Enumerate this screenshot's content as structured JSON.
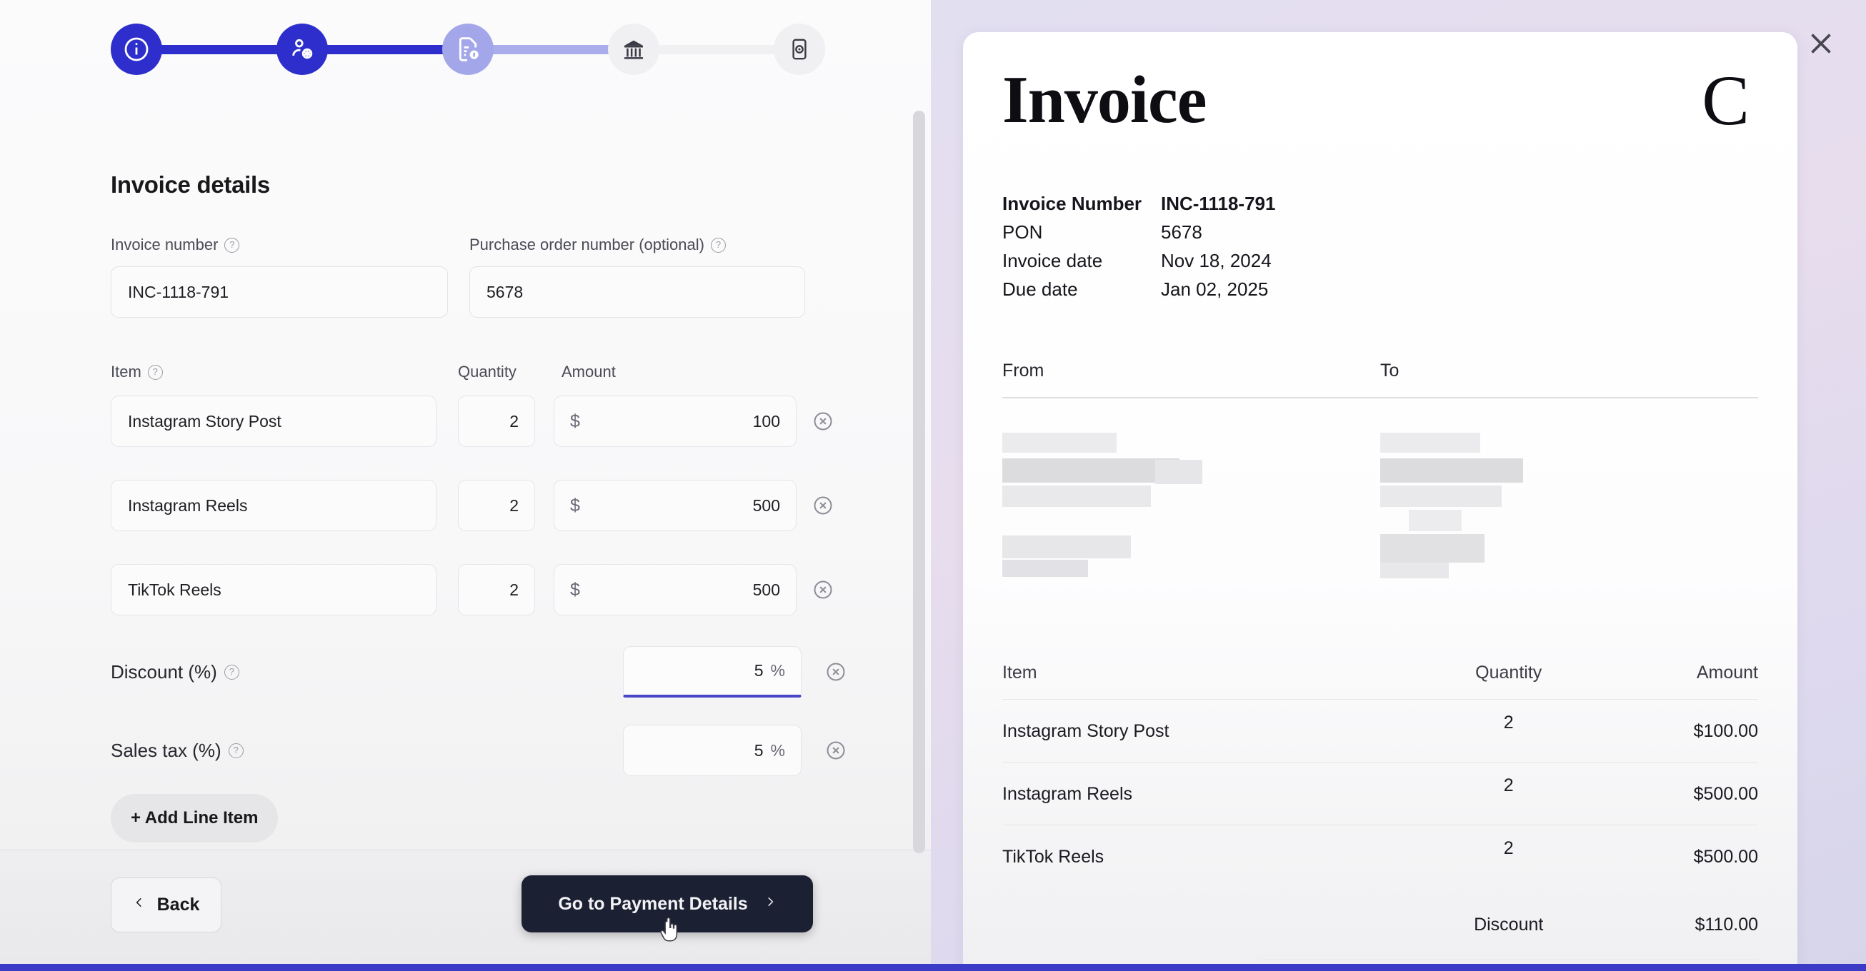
{
  "stepper": {
    "steps": [
      {
        "name": "business-info",
        "icon": "info-icon",
        "state": "done"
      },
      {
        "name": "client-details",
        "icon": "user-package-icon",
        "state": "done"
      },
      {
        "name": "invoice-details",
        "icon": "invoice-document-icon",
        "state": "current"
      },
      {
        "name": "payment-details",
        "icon": "bank-icon",
        "state": "todo"
      },
      {
        "name": "review-send",
        "icon": "preview-phone-icon",
        "state": "todo"
      }
    ],
    "colors": {
      "done": "#2e2ecc",
      "current": "#a3a7ea",
      "todo": "#f0f0f3"
    }
  },
  "form": {
    "title": "Invoice details",
    "invoice_number": {
      "label": "Invoice number",
      "value": "INC-1118-791",
      "placeholder": "Invoice number",
      "help": "?"
    },
    "purchase_order": {
      "label": "Purchase order number (optional)",
      "value": "5678",
      "placeholder": "Purchase order number",
      "help": "?"
    },
    "line_item_headers": {
      "item": "Item",
      "quantity": "Quantity",
      "amount": "Amount",
      "help": "?"
    },
    "currency_symbol": "$",
    "line_items": [
      {
        "item": "Instagram Story Post",
        "quantity": "2",
        "amount": "100"
      },
      {
        "item": "Instagram Reels",
        "quantity": "2",
        "amount": "500"
      },
      {
        "item": "TikTok Reels",
        "quantity": "2",
        "amount": "500"
      }
    ],
    "discount": {
      "label": "Discount (%)",
      "value": "5",
      "unit": "%",
      "help": "?",
      "focused": true,
      "focus_color": "#4a46c9"
    },
    "sales_tax": {
      "label": "Sales tax (%)",
      "value": "5",
      "unit": "%",
      "help": "?",
      "focused": false
    },
    "add_line_item_label": "+ Add Line Item",
    "back_label": "Back",
    "next_label": "Go to Payment Details"
  },
  "preview": {
    "close_label": "Close",
    "title": "Invoice",
    "logo": "C",
    "meta": [
      {
        "key": "Invoice Number",
        "value": "INC-1118-791",
        "bold": true
      },
      {
        "key": "PON",
        "value": "5678",
        "bold": false
      },
      {
        "key": "Invoice date",
        "value": "Nov 18, 2024",
        "bold": false
      },
      {
        "key": "Due date",
        "value": "Jan 02, 2025",
        "bold": false
      }
    ],
    "from_label": "From",
    "to_label": "To",
    "table": {
      "headers": {
        "item": "Item",
        "quantity": "Quantity",
        "amount": "Amount"
      },
      "rows": [
        {
          "item": "Instagram Story Post",
          "quantity": "2",
          "amount": "$100.00"
        },
        {
          "item": "Instagram Reels",
          "quantity": "2",
          "amount": "$500.00"
        },
        {
          "item": "TikTok Reels",
          "quantity": "2",
          "amount": "$500.00"
        }
      ],
      "summary": [
        {
          "label": "Discount",
          "amount": "$110.00"
        }
      ]
    }
  }
}
